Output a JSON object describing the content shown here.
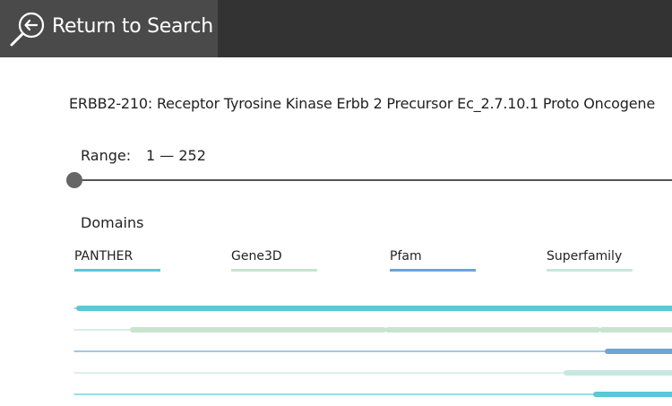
{
  "header": {
    "return_label": "Return to Search",
    "return_icon": "search-back-icon"
  },
  "protein": {
    "title": "ERBB2-210: Receptor Tyrosine Kinase Erbb 2 Precursor Ec_2.7.10.1 Proto Oncogene"
  },
  "range": {
    "label": "Range:",
    "value": "1 — 252",
    "start": 1,
    "end": 252
  },
  "domains": {
    "heading": "Domains",
    "legend": [
      {
        "name": "PANTHER",
        "color": "#5bc8d6"
      },
      {
        "name": "Gene3D",
        "color": "#c8e4cf"
      },
      {
        "name": "Pfam",
        "color": "#6fa3d8"
      },
      {
        "name": "Superfamily",
        "color": "#c6e8e0"
      }
    ]
  },
  "colors": {
    "topbar": "#333333",
    "return_button": "#4a4a4a"
  }
}
